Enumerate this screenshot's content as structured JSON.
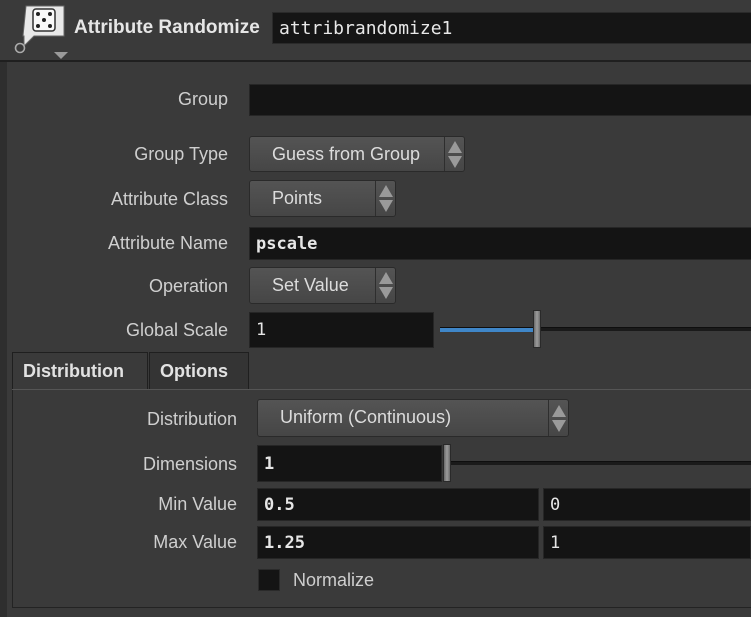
{
  "node": {
    "type_label": "Attribute Randomize",
    "name": "attribrandomize1"
  },
  "icons": {
    "node_icon": "dice-icon"
  },
  "params": {
    "group": {
      "label": "Group",
      "value": ""
    },
    "group_type": {
      "label": "Group Type",
      "value": "Guess from Group"
    },
    "attribute_class": {
      "label": "Attribute Class",
      "value": "Points"
    },
    "attribute_name": {
      "label": "Attribute Name",
      "value": "pscale"
    },
    "operation": {
      "label": "Operation",
      "value": "Set Value"
    },
    "global_scale": {
      "label": "Global Scale",
      "value": "1",
      "slider_fraction": 0.31
    }
  },
  "tabs": [
    {
      "label": "Distribution",
      "active": true
    },
    {
      "label": "Options",
      "active": false
    }
  ],
  "distribution_tab": {
    "distribution": {
      "label": "Distribution",
      "value": "Uniform (Continuous)"
    },
    "dimensions": {
      "label": "Dimensions",
      "value": "1",
      "slider_fraction": 0.0
    },
    "min_value": {
      "label": "Min Value",
      "values": [
        "0.5",
        "0"
      ]
    },
    "max_value": {
      "label": "Max Value",
      "values": [
        "1.25",
        "1"
      ]
    },
    "normalize": {
      "label": "Normalize",
      "checked": false
    }
  },
  "colors": {
    "background": "#3a3a3a",
    "field": "#141414",
    "slider_fill": "#3f86c8"
  }
}
